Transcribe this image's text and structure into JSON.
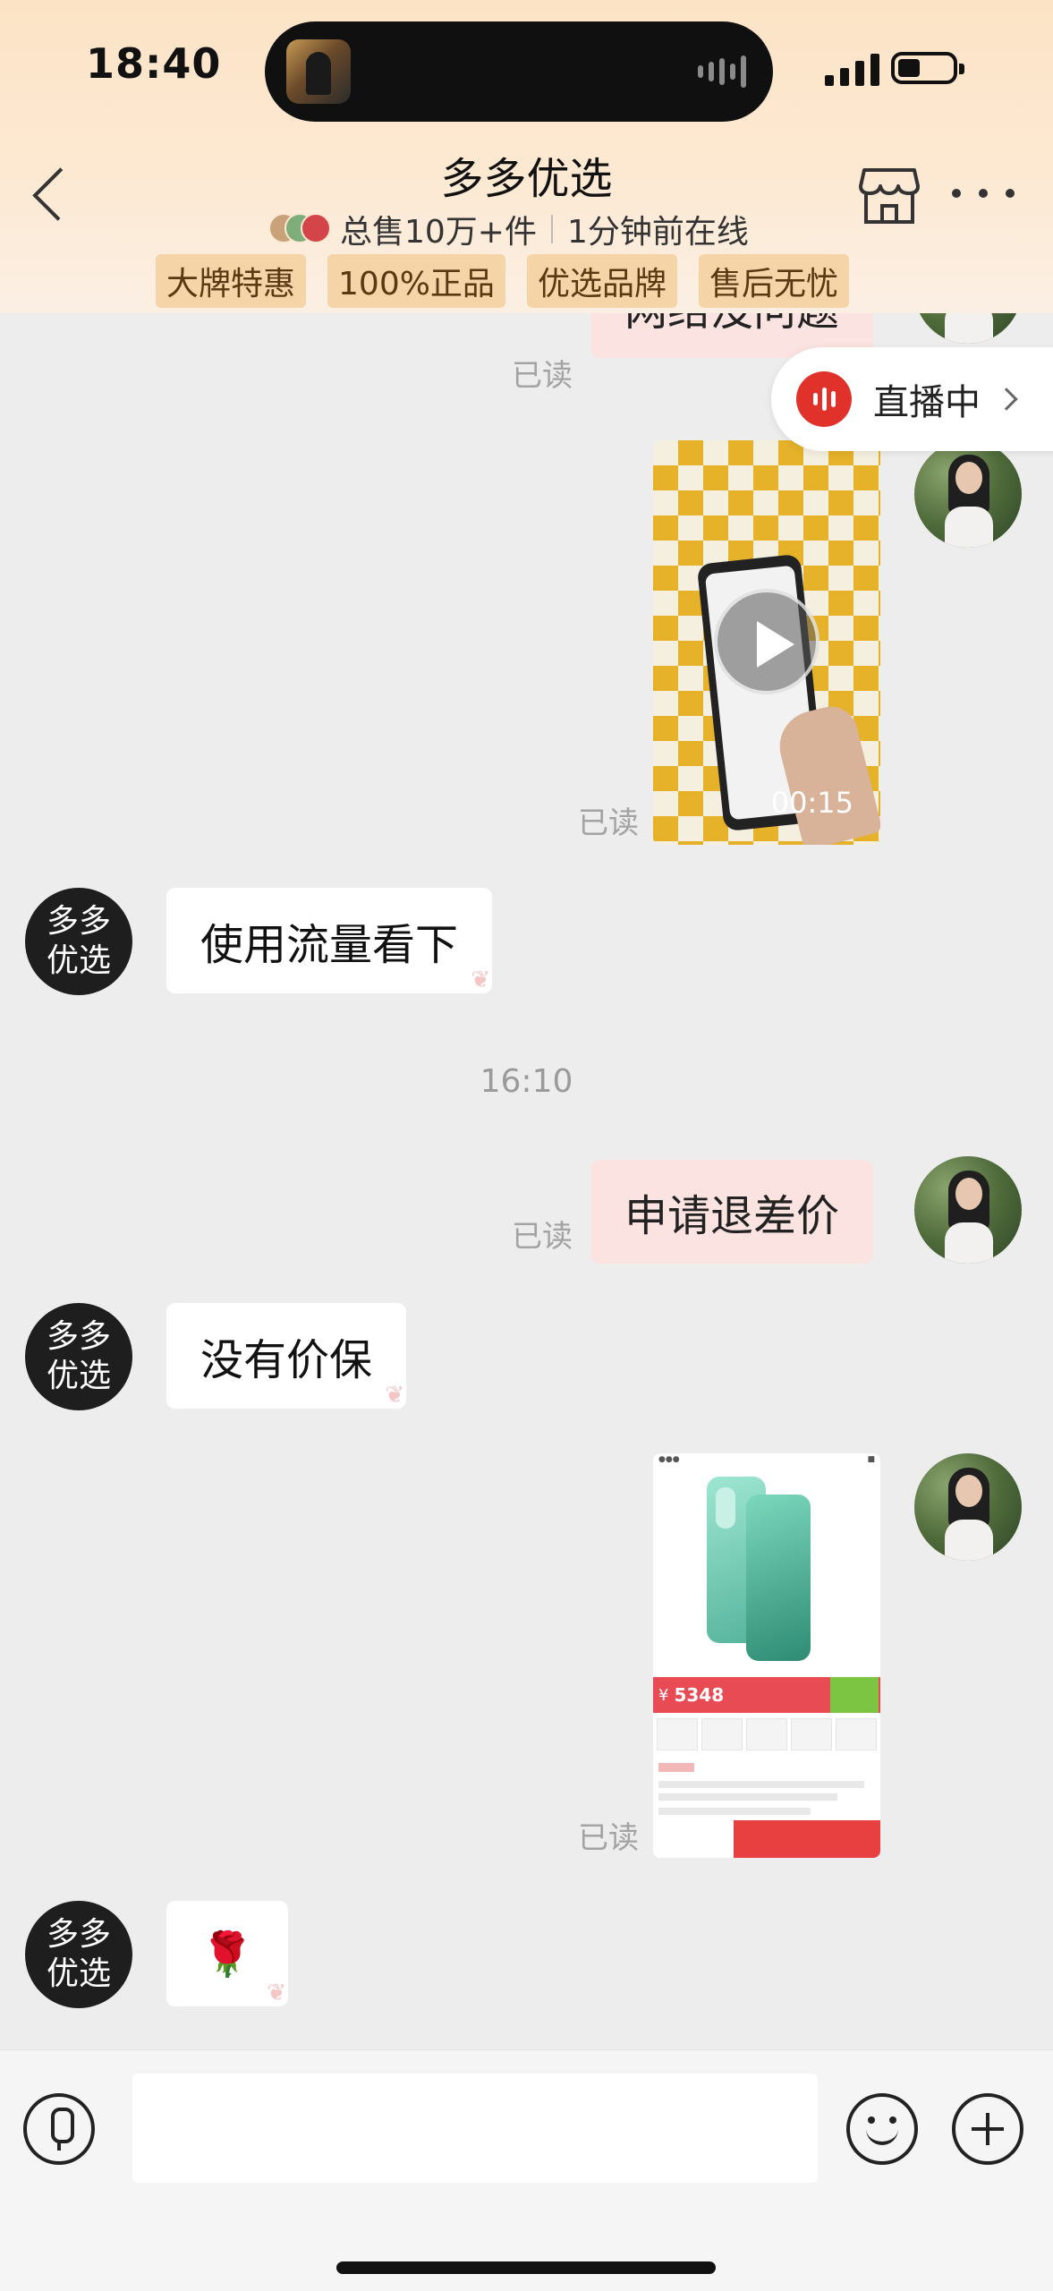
{
  "status_bar": {
    "time": "18:40"
  },
  "header": {
    "title": "多多优选",
    "total_sales": "总售10万+件",
    "online_status": "1分钟前在线",
    "tags": [
      "大牌特惠",
      "100%正品",
      "优选品牌",
      "售后无忧"
    ],
    "icons": {
      "back": "chevron-left-icon",
      "shop": "store-icon",
      "more": "more-dots-icon"
    }
  },
  "live": {
    "label": "直播中"
  },
  "messages": {
    "m1": {
      "text": "网络没问题",
      "read": "已读"
    },
    "m2": {
      "duration": "00:15",
      "read": "已读"
    },
    "m3": {
      "sender": "多多优选",
      "text": "使用流量看下"
    },
    "timestamp": "16:10",
    "m4": {
      "text": "申请退差价",
      "read": "已读"
    },
    "m5": {
      "sender": "多多优选",
      "text": "没有价保"
    },
    "m6": {
      "read": "已读",
      "price": "5348"
    },
    "m7": {
      "sender": "多多优选",
      "emoji": "🌹"
    }
  },
  "shop_avatar": {
    "line1": "多多",
    "line2": "优选"
  },
  "input": {
    "placeholder": "",
    "icons": [
      "mic-icon",
      "emoji-icon",
      "plus-icon"
    ]
  },
  "colors": {
    "accent_live": "#e0322b",
    "bubble_out": "#fae3e0",
    "bubble_in": "#ffffff",
    "tag_bg": "#f5d4a8",
    "header_bg": "#fde9d2"
  }
}
